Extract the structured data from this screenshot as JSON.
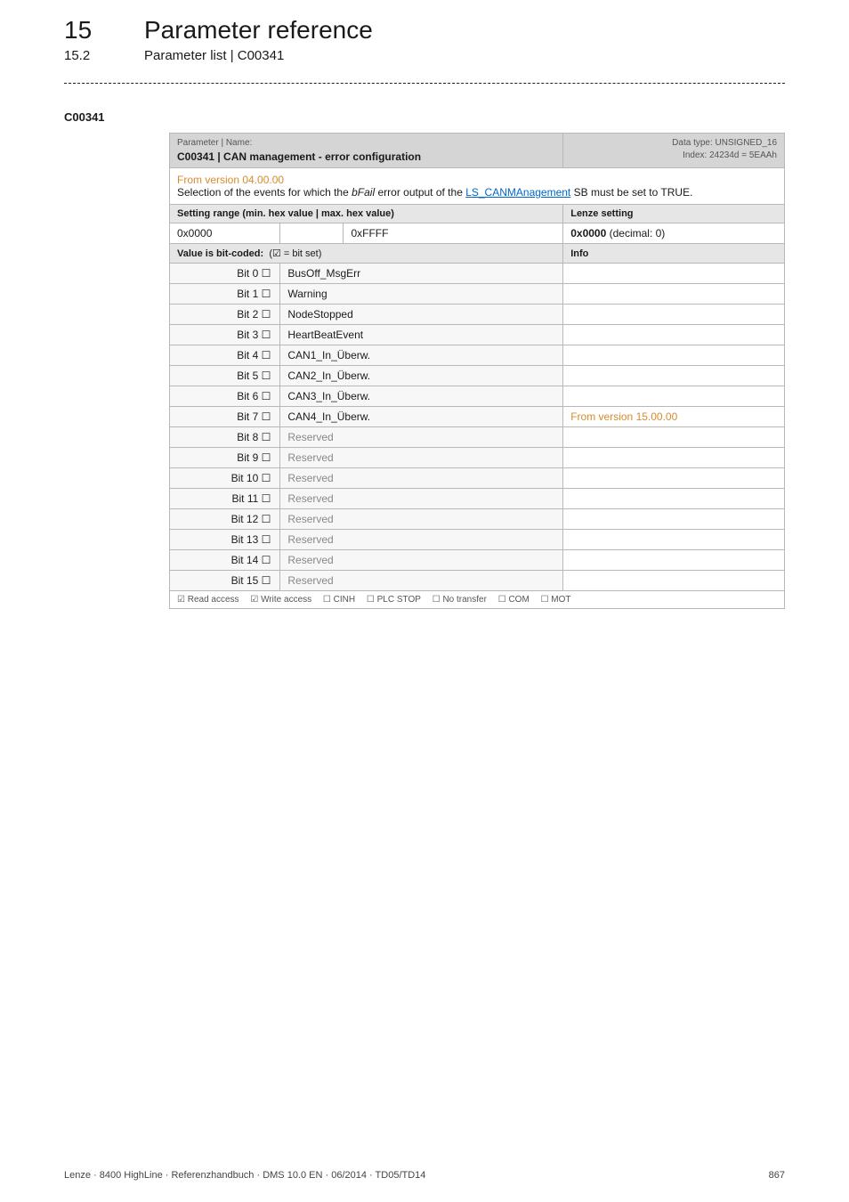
{
  "header": {
    "chapter_number": "15",
    "chapter_title": "Parameter reference",
    "section_number": "15.2",
    "section_title": "Parameter list | C00341"
  },
  "param_code": "C00341",
  "table_header": {
    "label": "Parameter | Name:",
    "name": "C00341 | CAN management - error configuration",
    "datatype": "Data type: UNSIGNED_16",
    "index": "Index: 24234d = 5EAAh"
  },
  "note": {
    "version_line": "From version 04.00.00",
    "desc_pre": "Selection of the events for which the ",
    "desc_ital": "bFail",
    "desc_mid": " error output of the ",
    "desc_link": "LS_CANMAnagement",
    "desc_post": " SB must be set to TRUE."
  },
  "setting_row": {
    "left_label": "Setting range (min. hex value | max. hex value)",
    "right_label": "Lenze setting"
  },
  "value_row": {
    "min": "0x0000",
    "max": "0xFFFF",
    "setting": "0x0000",
    "setting_suffix": " (decimal: 0)"
  },
  "bitcoded_row": {
    "left": "Value is bit-coded:",
    "left_suffix": "(☑ = bit set)",
    "right": "Info"
  },
  "bits": [
    {
      "bit": "Bit 0 ☐",
      "name": "BusOff_MsgErr",
      "info": "",
      "gray": false
    },
    {
      "bit": "Bit 1 ☐",
      "name": "Warning",
      "info": "",
      "gray": false
    },
    {
      "bit": "Bit 2 ☐",
      "name": "NodeStopped",
      "info": "",
      "gray": false
    },
    {
      "bit": "Bit 3 ☐",
      "name": "HeartBeatEvent",
      "info": "",
      "gray": false
    },
    {
      "bit": "Bit 4 ☐",
      "name": "CAN1_In_Überw.",
      "info": "",
      "gray": false
    },
    {
      "bit": "Bit 5 ☐",
      "name": "CAN2_In_Überw.",
      "info": "",
      "gray": false
    },
    {
      "bit": "Bit 6 ☐",
      "name": "CAN3_In_Überw.",
      "info": "",
      "gray": false
    },
    {
      "bit": "Bit 7 ☐",
      "name": "CAN4_In_Überw.",
      "info": "From version 15.00.00",
      "gray": false,
      "info_orange": true
    },
    {
      "bit": "Bit 8 ☐",
      "name": "Reserved",
      "info": "",
      "gray": true
    },
    {
      "bit": "Bit 9 ☐",
      "name": "Reserved",
      "info": "",
      "gray": true
    },
    {
      "bit": "Bit 10 ☐",
      "name": "Reserved",
      "info": "",
      "gray": true
    },
    {
      "bit": "Bit 11 ☐",
      "name": "Reserved",
      "info": "",
      "gray": true
    },
    {
      "bit": "Bit 12 ☐",
      "name": "Reserved",
      "info": "",
      "gray": true
    },
    {
      "bit": "Bit 13 ☐",
      "name": "Reserved",
      "info": "",
      "gray": true
    },
    {
      "bit": "Bit 14 ☐",
      "name": "Reserved",
      "info": "",
      "gray": true
    },
    {
      "bit": "Bit 15 ☐",
      "name": "Reserved",
      "info": "",
      "gray": true
    }
  ],
  "access_row": {
    "read": "☑ Read access",
    "write": "☑ Write access",
    "cinh": "☐ CINH",
    "plc": "☐ PLC STOP",
    "notrans": "☐ No transfer",
    "com": "☐ COM",
    "mot": "☐ MOT"
  },
  "footer": {
    "left": "Lenze · 8400 HighLine · Referenzhandbuch · DMS 10.0 EN · 06/2014 · TD05/TD14",
    "right": "867"
  }
}
